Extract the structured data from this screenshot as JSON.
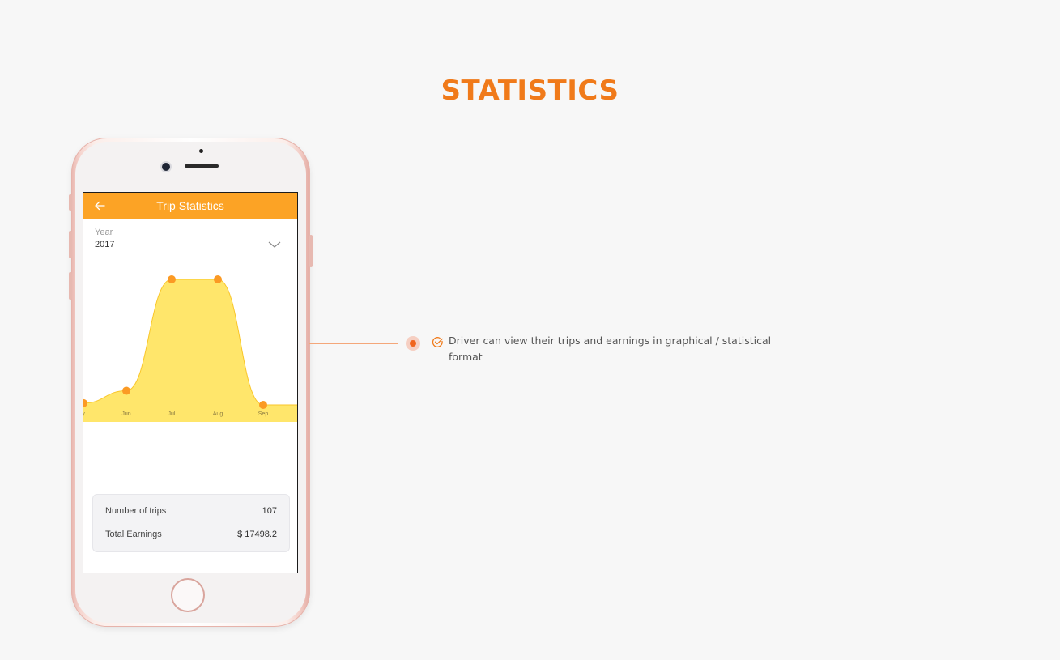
{
  "page": {
    "title": "STATISTICS",
    "accent_color": "#f07a1a",
    "feature_text": "Driver can view their trips and earnings in graphical / statistical format"
  },
  "app": {
    "appbar_title": "Trip Statistics",
    "appbar_color": "#fca325",
    "back_icon": "arrow-left-icon",
    "year_label": "Year",
    "year_value": "2017",
    "stats": [
      {
        "label": "Number of trips",
        "value": "107"
      },
      {
        "label": "Total Earnings",
        "value": "$ 17498.2"
      }
    ]
  },
  "chart_data": {
    "type": "area",
    "categories": [
      "May",
      "Jun",
      "Jul",
      "Aug",
      "Sep"
    ],
    "tick_labels": [
      "y",
      "Jun",
      "Jul",
      "Aug",
      "Sep"
    ],
    "values": [
      1,
      8,
      71,
      71,
      0
    ],
    "fill_color": "#ffe66b",
    "line_color": "#f9c62a",
    "point_color": "#fb9a24",
    "grid": false,
    "legend": "none"
  }
}
